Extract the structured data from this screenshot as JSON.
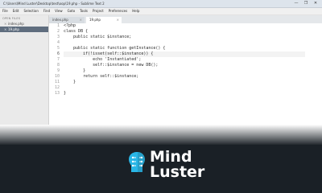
{
  "window": {
    "title": "C:\\Users\\Mind Luster\\Desktop\\test\\oop\\19.php - Sublime Text 2",
    "controls": [
      "—",
      "❐",
      "✕"
    ]
  },
  "menu": [
    "File",
    "Edit",
    "Selection",
    "Find",
    "View",
    "Goto",
    "Tools",
    "Project",
    "Preferences",
    "Help"
  ],
  "sidebar": {
    "header": "OPEN FILES",
    "files": [
      {
        "name": "index.php",
        "active": false
      },
      {
        "name": "19.php",
        "active": true
      }
    ]
  },
  "tabs": [
    {
      "label": "index.php",
      "active": false
    },
    {
      "label": "19.php",
      "active": true
    }
  ],
  "editor": {
    "current_line": 6,
    "line_numbers": [
      "1",
      "2",
      "3",
      "4",
      "5",
      "6",
      "7",
      "8",
      "9",
      "10",
      "11",
      "12",
      "13"
    ],
    "lines": [
      "<?php",
      "class DB {",
      "    public static $instance;",
      "",
      "    public static function getInstance() {",
      "        if(!isset(self::$instance)) {",
      "            echo 'Instantiated';",
      "            self::$instance = new DB();",
      "        }",
      "        return self::$instance;",
      "    }",
      "",
      "}"
    ]
  },
  "brand": {
    "line1": "Mind",
    "line2": "Luster",
    "logo_icon": "brain-circuit-icon"
  },
  "colors": {
    "bottom_bg": "#1a2026",
    "logo": "#29b6e6",
    "keyword": "#8a3ab9"
  }
}
